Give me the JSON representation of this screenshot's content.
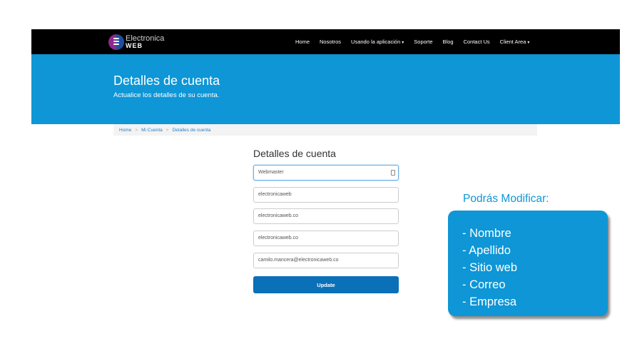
{
  "brand": {
    "name_top": "Electronica",
    "name_bottom": "WEB"
  },
  "nav": {
    "items": [
      {
        "label": "Home",
        "caret": ""
      },
      {
        "label": "Nosotros",
        "caret": ""
      },
      {
        "label": "Usando la aplicación",
        "caret": "▾"
      },
      {
        "label": "Soporte",
        "caret": ""
      },
      {
        "label": "Blog",
        "caret": ""
      },
      {
        "label": "Contact Us",
        "caret": ""
      },
      {
        "label": "Client Area",
        "caret": "▾"
      }
    ]
  },
  "hero": {
    "title": "Detalles de cuenta",
    "subtitle": "Actualice los detalles de su cuenta."
  },
  "breadcrumb": {
    "items": [
      "Home",
      "Mi Cuenta",
      "Detalles de cuenta"
    ],
    "separator": ">"
  },
  "form": {
    "title": "Detalles de cuenta",
    "fields": [
      {
        "value": "Webmaster"
      },
      {
        "value": "electronicaweb"
      },
      {
        "value": "electronicaweb.co"
      },
      {
        "value": "electronicaweb.co"
      },
      {
        "value": "camilo.mancera@electronicaweb.co"
      }
    ],
    "submit_label": "Update"
  },
  "callout": {
    "title": "Podrás Modificar:",
    "items": [
      "- Nombre",
      "- Apellido",
      "- Sitio web",
      "- Correo",
      "- Empresa"
    ]
  },
  "colors": {
    "navbar": "#000000",
    "hero": "#0e96d6",
    "button": "#0a70b8",
    "link": "#2b80c5"
  }
}
